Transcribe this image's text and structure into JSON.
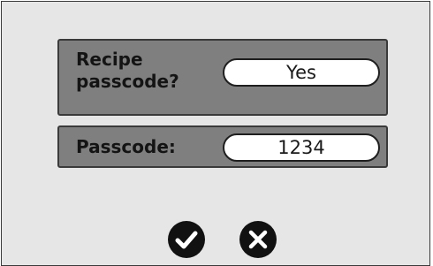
{
  "recipe_passcode": {
    "label": "Recipe passcode?",
    "value": "Yes"
  },
  "passcode": {
    "label": "Passcode:",
    "value": "1234"
  },
  "actions": {
    "confirm_icon": "check-icon",
    "cancel_icon": "close-icon"
  },
  "colors": {
    "panel_background": "#e6e6e6",
    "row_background": "#7f7f7f",
    "field_background": "#ffffff",
    "icon_color": "#111111"
  }
}
